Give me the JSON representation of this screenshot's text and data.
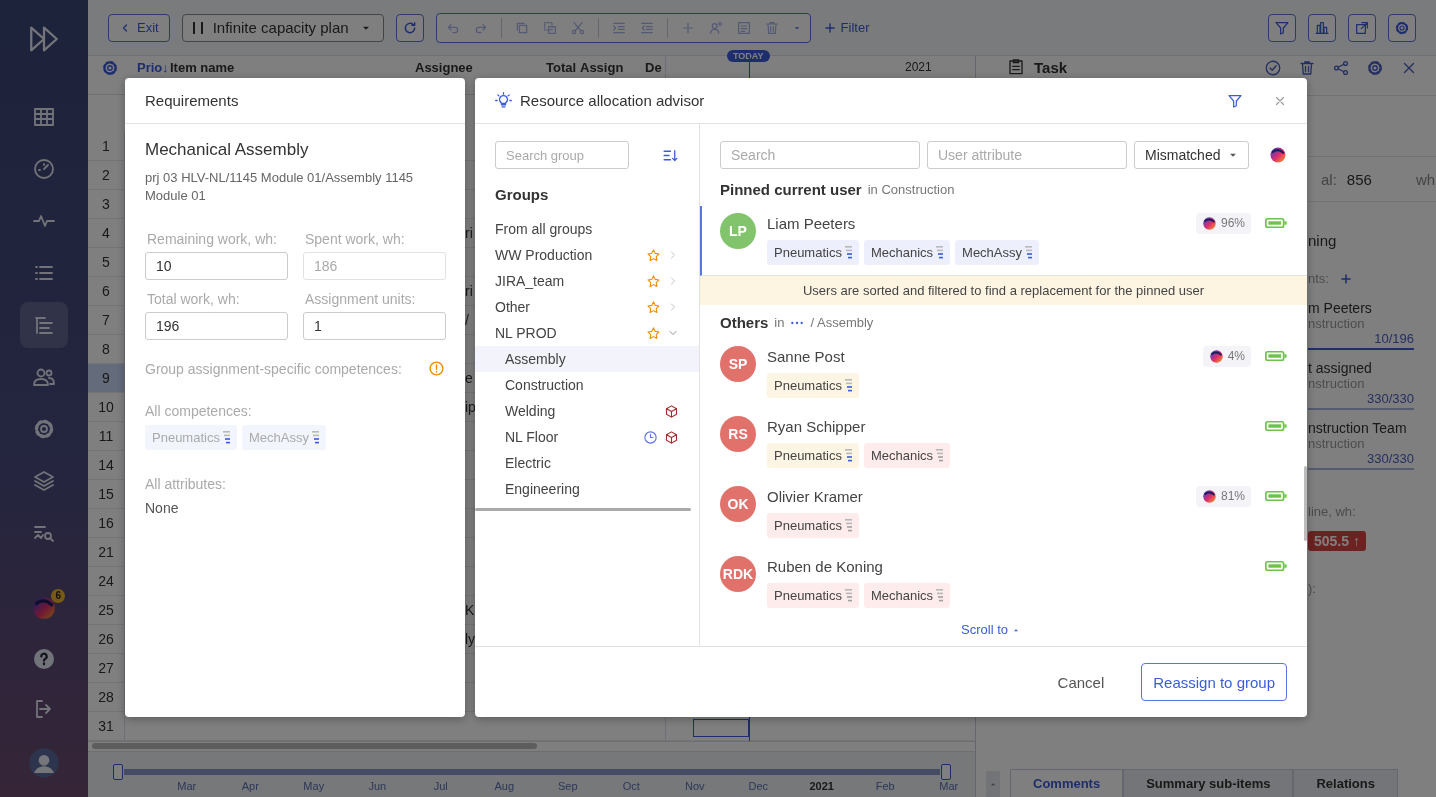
{
  "sidebar": {
    "nav": [
      {
        "kind": "table",
        "selected": false
      },
      {
        "kind": "gauge",
        "selected": false
      },
      {
        "kind": "pulse",
        "selected": false
      },
      {
        "kind": "list",
        "selected": false
      },
      {
        "kind": "tree",
        "selected": true
      },
      {
        "kind": "people",
        "selected": false
      },
      {
        "kind": "gear",
        "selected": false
      },
      {
        "kind": "layers",
        "selected": false
      },
      {
        "kind": "chart-search",
        "selected": false
      }
    ],
    "advisor_badge": "6"
  },
  "toolbar": {
    "exit": "Exit",
    "plan": "Infinite capacity plan",
    "filter": "Filter"
  },
  "grid": {
    "columns": [
      "Prio",
      "Item name",
      "Assignee",
      "Total",
      "Assign",
      "De"
    ],
    "sort_mark": "↓",
    "today": "TODAY",
    "year": "2021",
    "rows": [
      {
        "number": "1",
        "selected": false
      },
      {
        "number": "2",
        "selected": false
      },
      {
        "number": "3",
        "selected": false
      },
      {
        "number": "4",
        "selected": false,
        "fragment": "ri"
      },
      {
        "number": "5",
        "selected": false
      },
      {
        "number": "6",
        "selected": false,
        "fragment": "ri"
      },
      {
        "number": "7",
        "selected": false,
        "fragment": "/"
      },
      {
        "number": "8",
        "selected": false
      },
      {
        "number": "9",
        "selected": true,
        "fragment": "e"
      },
      {
        "number": "10",
        "selected": false,
        "fragment": "ip"
      },
      {
        "number": "11",
        "selected": false
      },
      {
        "number": "14",
        "selected": false
      },
      {
        "number": "15",
        "selected": false
      },
      {
        "number": "16",
        "selected": false
      },
      {
        "number": "21",
        "selected": false
      },
      {
        "number": "24",
        "selected": false
      },
      {
        "number": "25",
        "selected": false,
        "fragment": "K"
      },
      {
        "number": "26",
        "selected": false,
        "fragment": "ly"
      },
      {
        "number": "27",
        "selected": false
      },
      {
        "number": "28",
        "selected": false
      },
      {
        "number": "31",
        "selected": false
      }
    ]
  },
  "timeline": {
    "labels": [
      {
        "text": "Mar",
        "kind": "month"
      },
      {
        "text": "Apr",
        "kind": "month"
      },
      {
        "text": "May",
        "kind": "month"
      },
      {
        "text": "Jun",
        "kind": "month"
      },
      {
        "text": "Jul",
        "kind": "month"
      },
      {
        "text": "Aug",
        "kind": "month"
      },
      {
        "text": "Sep",
        "kind": "month"
      },
      {
        "text": "Oct",
        "kind": "month"
      },
      {
        "text": "Nov",
        "kind": "month"
      },
      {
        "text": "Dec",
        "kind": "month"
      },
      {
        "text": "2021",
        "kind": "year"
      },
      {
        "text": "Feb",
        "kind": "month"
      },
      {
        "text": "Mar",
        "kind": "month"
      }
    ]
  },
  "task_panel": {
    "title": "Task",
    "total_label": "al:",
    "total_value": "856",
    "total_unit": "wh",
    "status": "ning",
    "assignments_label": "nts:",
    "assignments": [
      {
        "name": "m Peeters",
        "group": "nstruction",
        "hours": "10/196",
        "active": true
      },
      {
        "name": "t assigned",
        "group": "nstruction",
        "hours": "330/330",
        "active": false
      },
      {
        "name": "nstruction Team",
        "group": "nstruction",
        "hours": "330/330",
        "active": false
      }
    ],
    "baseline_label": "line, wh:",
    "baseline_badge": "505.5 ↑",
    "last_label": "):",
    "tabs": [
      {
        "label": "Comments",
        "selected": true
      },
      {
        "label": "Summary sub-items",
        "selected": false
      },
      {
        "label": "Relations",
        "selected": false
      }
    ]
  },
  "requirements": {
    "title": "Requirements",
    "item": "Mechanical Assembly",
    "path": "prj 03 HLV-NL/1145 Module 01/Assembly 1145 Module 01",
    "fields": [
      {
        "label": "Remaining work, wh:",
        "value": "10",
        "disabled": false
      },
      {
        "label": "Spent work, wh:",
        "value": "186",
        "disabled": true
      },
      {
        "label": "Total work, wh:",
        "value": "196",
        "disabled": false
      },
      {
        "label": "Assignment units:",
        "value": "1",
        "disabled": false
      }
    ],
    "group_competences_label": "Group assignment-specific competences:",
    "warning": true,
    "competences_label": "All competences:",
    "competences": [
      "Pneumatics",
      "MechAssy"
    ],
    "attributes_label": "All attributes:",
    "attributes_value": "None"
  },
  "advisor": {
    "title": "Resource allocation advisor",
    "group_search": {
      "placeholder": "Search group"
    },
    "groups_title": "Groups",
    "groups": [
      {
        "label": "From all groups",
        "selected": false,
        "starred": false
      },
      {
        "label": "WW Production",
        "selected": false,
        "starred": true,
        "expanded": false
      },
      {
        "label": "JIRA_team",
        "selected": false,
        "starred": true,
        "expanded": false
      },
      {
        "label": "Other",
        "selected": false,
        "starred": true,
        "expanded": false
      },
      {
        "label": "NL PROD",
        "selected": false,
        "starred": true,
        "expanded": true,
        "children": [
          {
            "label": "Assembly",
            "selected": true
          },
          {
            "label": "Construction",
            "selected": false
          },
          {
            "label": "Welding",
            "selected": false,
            "flags": [
              {
                "kind": "cube"
              }
            ]
          },
          {
            "label": "NL Floor",
            "selected": false,
            "flags": [
              {
                "kind": "clock"
              },
              {
                "kind": "cube"
              }
            ]
          },
          {
            "label": "Electric",
            "selected": false
          },
          {
            "label": "Engineering",
            "selected": false
          }
        ]
      }
    ],
    "search": {
      "placeholder": "Search"
    },
    "attribute": {
      "placeholder": "User attribute"
    },
    "match_filter": "Mismatched",
    "pinned_title": "Pinned current user",
    "pinned_context": "in Construction",
    "pinned": {
      "initials": "LP",
      "name": "Liam Peeters",
      "color": "#82c46c",
      "score": "96%",
      "competences": [
        {
          "label": "Pneumatics",
          "color": "#edf0fc",
          "met": true
        },
        {
          "label": "Mechanics",
          "color": "#edf0fc",
          "met": true
        },
        {
          "label": "MechAssy",
          "color": "#edf0fc",
          "met": true
        }
      ]
    },
    "notice": "Users are sorted and filtered to find a replacement for the pinned user",
    "others_title": "Others",
    "others_in": "in",
    "others_group": "/ Assembly",
    "users": [
      {
        "initials": "SP",
        "name": "Sanne Post",
        "color": "#e0716b",
        "score": "4%",
        "competences": [
          {
            "label": "Pneumatics",
            "color": "#fdf5e3",
            "met": true
          }
        ]
      },
      {
        "initials": "RS",
        "name": "Ryan Schipper",
        "color": "#e0716b",
        "competences": [
          {
            "label": "Pneumatics",
            "color": "#fdf5e3",
            "met": true
          },
          {
            "label": "Mechanics",
            "color": "#fdeceb",
            "met": false
          }
        ]
      },
      {
        "initials": "OK",
        "name": "Olivier Kramer",
        "color": "#e0716b",
        "score": "81%",
        "competences": [
          {
            "label": "Pneumatics",
            "color": "#fdeceb",
            "met": false
          }
        ]
      },
      {
        "initials": "RDK",
        "name": "Ruben de Koning",
        "color": "#e0716b",
        "competences": [
          {
            "label": "Pneumatics",
            "color": "#fdeceb",
            "met": false
          },
          {
            "label": "Mechanics",
            "color": "#fdeceb",
            "met": false
          }
        ]
      }
    ],
    "scroll_to": "Scroll to",
    "cancel": "Cancel",
    "confirm": "Reassign to group"
  }
}
